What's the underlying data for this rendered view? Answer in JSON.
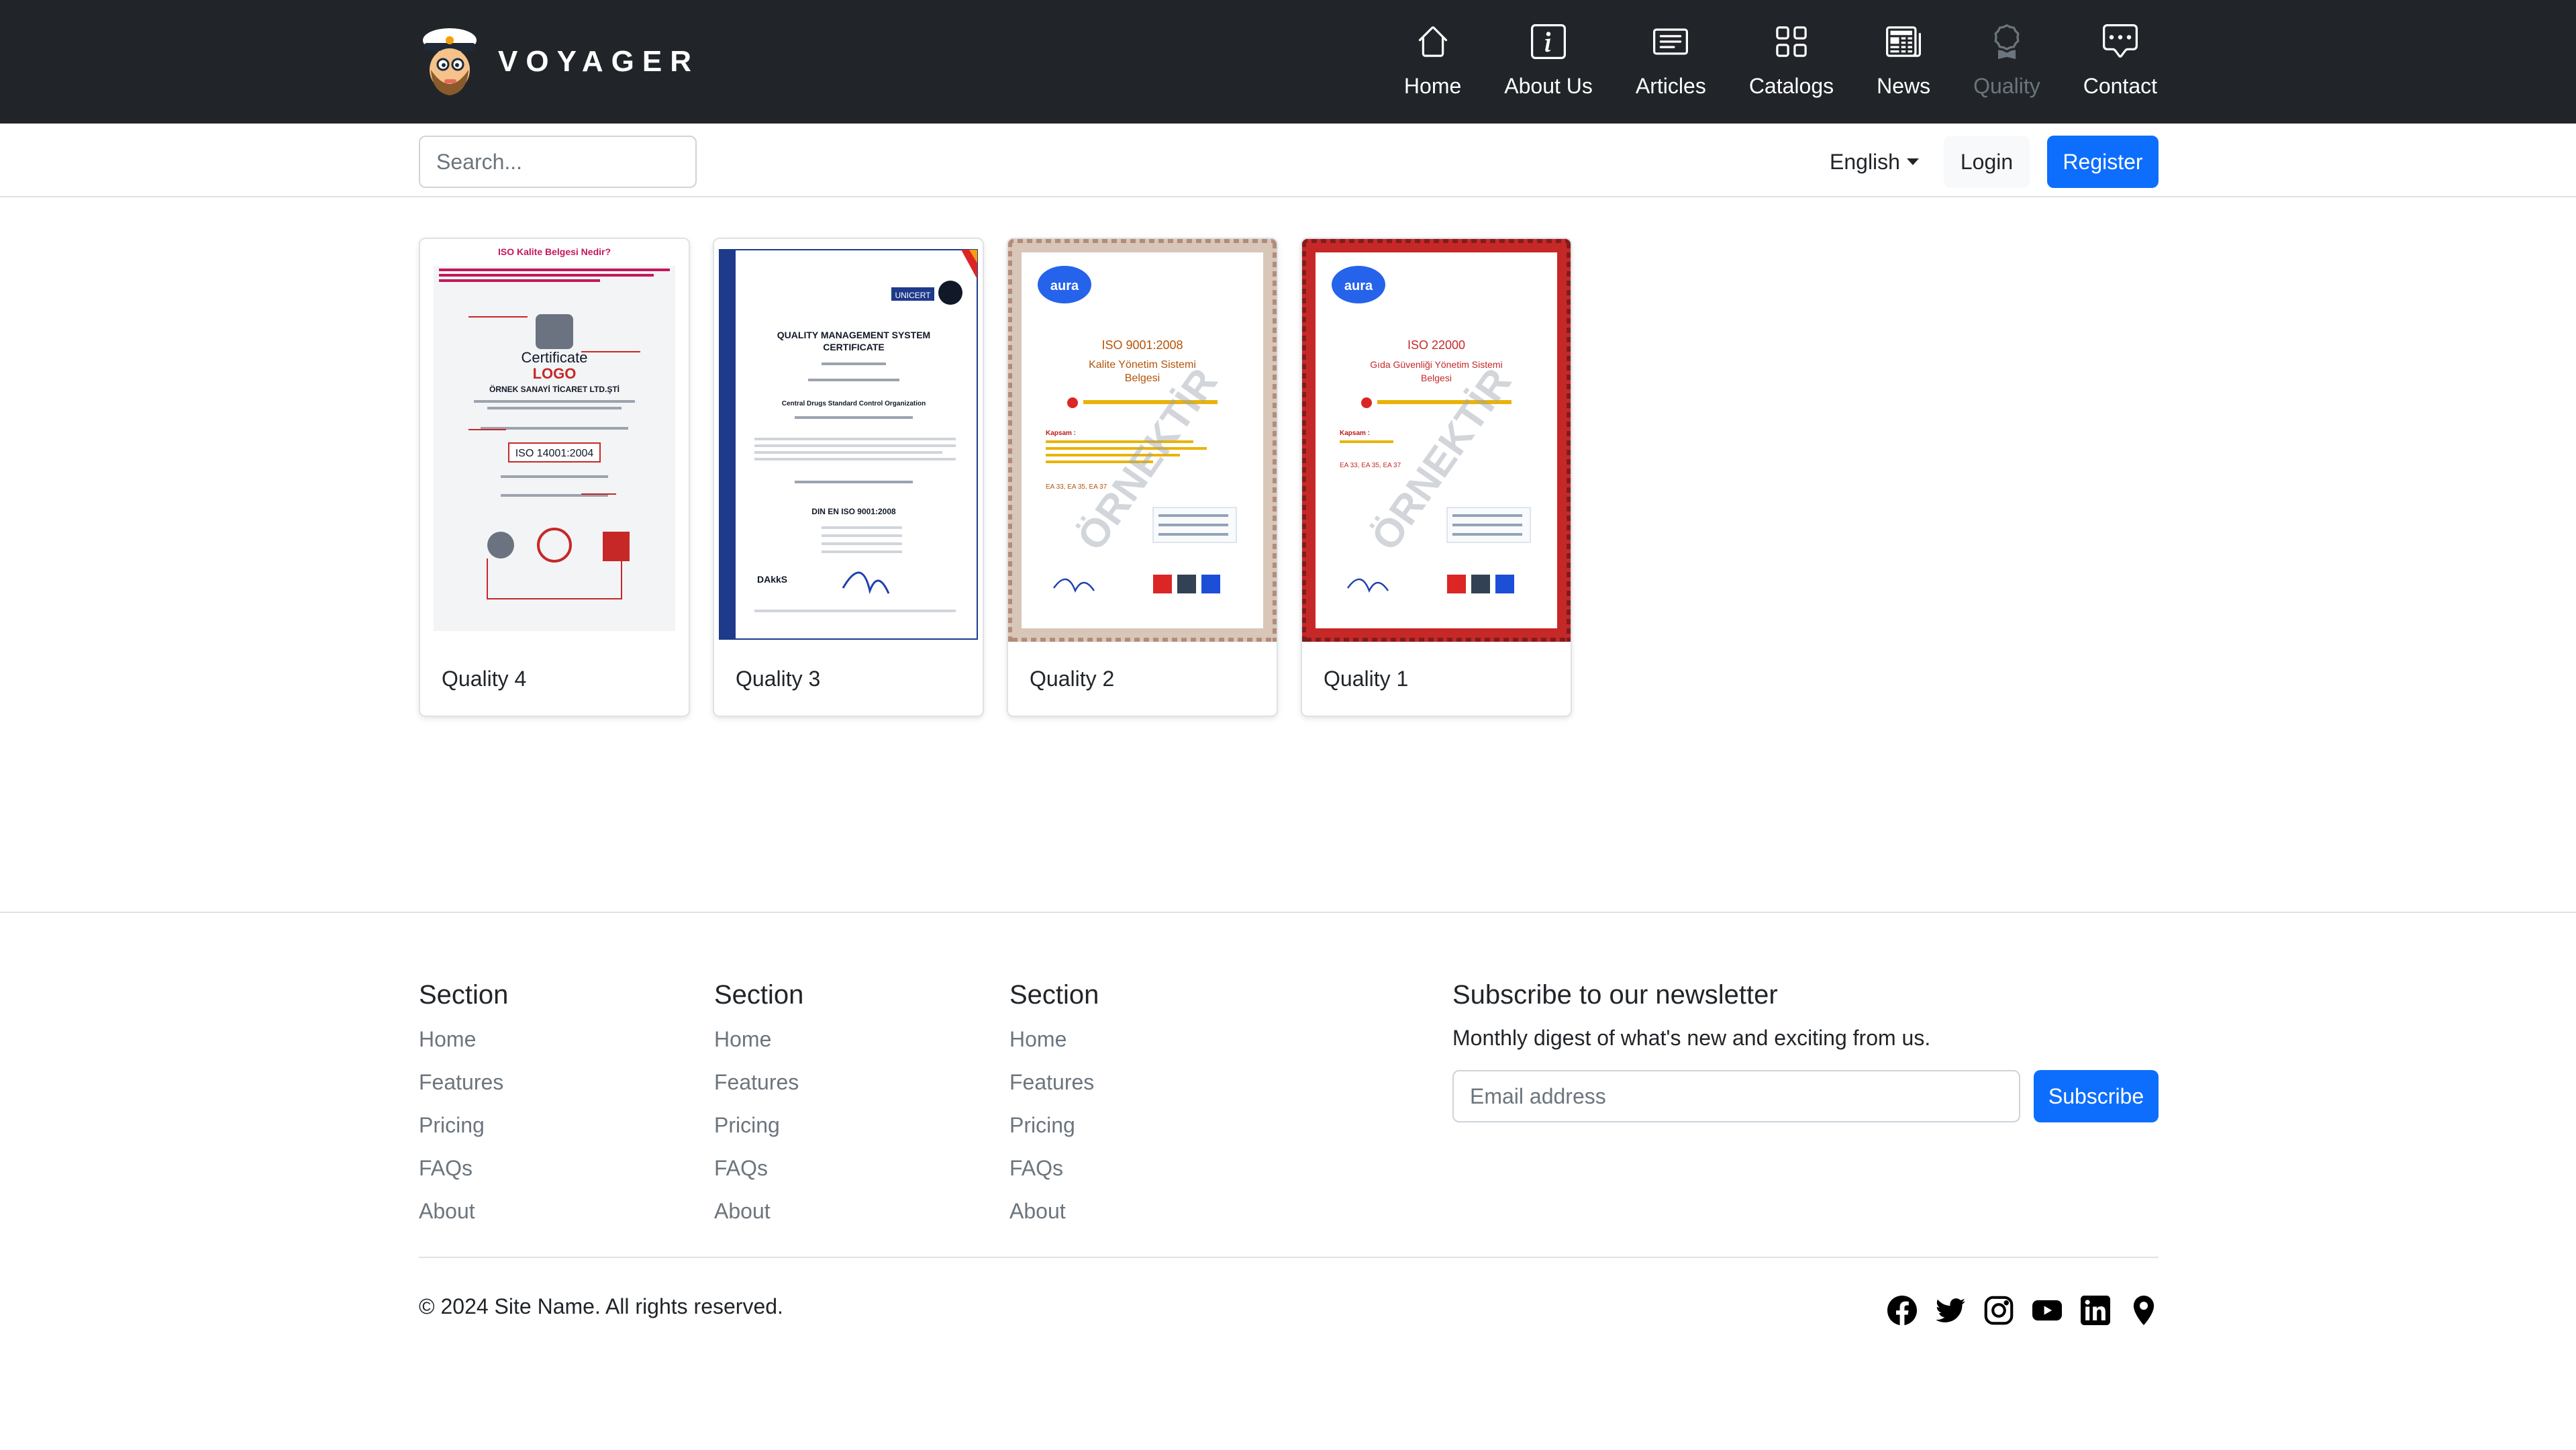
{
  "brand": {
    "name": "VOYAGER"
  },
  "nav": [
    {
      "label": "Home",
      "icon": "home-icon",
      "active": false
    },
    {
      "label": "About Us",
      "icon": "info-icon",
      "active": false
    },
    {
      "label": "Articles",
      "icon": "articles-icon",
      "active": false
    },
    {
      "label": "Catalogs",
      "icon": "grid-icon",
      "active": false
    },
    {
      "label": "News",
      "icon": "newspaper-icon",
      "active": false
    },
    {
      "label": "Quality",
      "icon": "award-icon",
      "active": true
    },
    {
      "label": "Contact",
      "icon": "chat-icon",
      "active": false
    }
  ],
  "search": {
    "placeholder": "Search..."
  },
  "language": {
    "selected": "English"
  },
  "auth": {
    "login_label": "Login",
    "register_label": "Register"
  },
  "documents": [
    {
      "title": "Quality 4",
      "image": {
        "heading": "ISO Kalite Belgesi Nedir?",
        "cert_word": "Certificate",
        "logo_word": "LOGO",
        "company": "ÖRNEK SANAYİ TİCARET LTD.ŞTİ",
        "standard": "ISO 14001:2004"
      }
    },
    {
      "title": "Quality 3",
      "image": {
        "issuer": "UNICERT",
        "heading1": "QUALITY MANAGEMENT SYSTEM",
        "heading2": "CERTIFICATE",
        "org": "Central Drugs Standard Control Organization",
        "standard": "DIN EN ISO 9001:2008",
        "accreditor": "DAkkS"
      }
    },
    {
      "title": "Quality 2",
      "image": {
        "brand": "aura",
        "standard": "ISO 9001:2008",
        "line1": "Kalite Yönetim Sistemi",
        "line2": "Belgesi",
        "watermark": "ÖRNEKTİR",
        "scope_label": "Kapsam :",
        "codes": "EA 33, EA 35, EA 37"
      }
    },
    {
      "title": "Quality 1",
      "image": {
        "brand": "aura",
        "standard": "ISO 22000",
        "line1": "Gıda Güvenliği Yönetim Sistemi",
        "line2": "Belgesi",
        "watermark": "ÖRNEKTİR",
        "scope_label": "Kapsam :",
        "codes": "EA 33, EA 35, EA 37"
      }
    }
  ],
  "footer": {
    "sections": [
      {
        "heading": "Section",
        "links": [
          "Home",
          "Features",
          "Pricing",
          "FAQs",
          "About"
        ]
      },
      {
        "heading": "Section",
        "links": [
          "Home",
          "Features",
          "Pricing",
          "FAQs",
          "About"
        ]
      },
      {
        "heading": "Section",
        "links": [
          "Home",
          "Features",
          "Pricing",
          "FAQs",
          "About"
        ]
      }
    ],
    "newsletter": {
      "heading": "Subscribe to our newsletter",
      "description": "Monthly digest of what's new and exciting from us.",
      "placeholder": "Email address",
      "button_label": "Subscribe"
    },
    "copyright": "© 2024 Site Name. All rights reserved.",
    "social": [
      "facebook-icon",
      "twitter-icon",
      "instagram-icon",
      "youtube-icon",
      "linkedin-icon",
      "location-pin-icon"
    ]
  },
  "colors": {
    "navbar_bg": "#212529",
    "primary": "#0d6efd",
    "muted": "#6c757d",
    "border": "#dee2e6",
    "cert_red": "#c62828",
    "cert_blue": "#1e3a8a"
  }
}
